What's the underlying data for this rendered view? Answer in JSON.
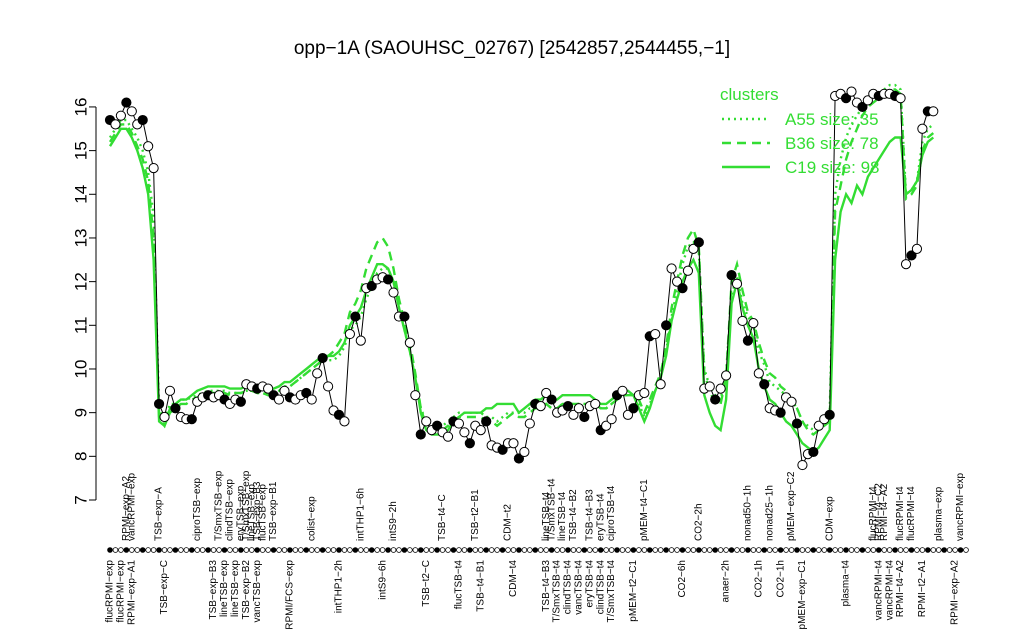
{
  "chart_data": {
    "type": "line",
    "title": "opp−1A (SAOUHSC_02767) [2542857,2544455,−1]",
    "ylim": [
      7,
      16.8
    ],
    "yticks": [
      7,
      8,
      9,
      10,
      11,
      12,
      13,
      14,
      15,
      16
    ],
    "n_samples": 158,
    "top_labels": [
      {
        "i": 3,
        "label": "RPMI−exp−A2"
      },
      {
        "i": 4,
        "label": "vancRPMI−exp"
      },
      {
        "i": 9,
        "label": "TSB−exp−A"
      },
      {
        "i": 16,
        "label": "ciproTSB−exp"
      },
      {
        "i": 20,
        "label": "T/SmxTSB−exp"
      },
      {
        "i": 22,
        "label": "clindTSB−exp"
      },
      {
        "i": 24,
        "label": "eryTSB−exp"
      },
      {
        "i": 25,
        "label": "T/SmxTSB−exp"
      },
      {
        "i": 26,
        "label": "lineTSB−exp"
      },
      {
        "i": 27,
        "label": "TSB−exp−B3"
      },
      {
        "i": 28,
        "label": "flucTSB−exp"
      },
      {
        "i": 30,
        "label": "TSB−exp−B1"
      },
      {
        "i": 37,
        "label": "colist−exp"
      },
      {
        "i": 46,
        "label": "intTHP1−6h"
      },
      {
        "i": 52,
        "label": "intS9−2h"
      },
      {
        "i": 61,
        "label": "TSB−t4−C"
      },
      {
        "i": 67,
        "label": "TSB−t2−B1"
      },
      {
        "i": 73,
        "label": "CDM−t2"
      },
      {
        "i": 80,
        "label": "lineTSB−t4"
      },
      {
        "i": 81,
        "label": "T/SmxTSB−t4"
      },
      {
        "i": 83,
        "label": "lineTSB−t4"
      },
      {
        "i": 85,
        "label": "TSB−t4−B2"
      },
      {
        "i": 88,
        "label": "TSB−t4−B3"
      },
      {
        "i": 90,
        "label": "eryTSB−t4"
      },
      {
        "i": 92,
        "label": "ciproTSB−t4"
      },
      {
        "i": 98,
        "label": "pMEM−t4−C1"
      },
      {
        "i": 108,
        "label": "CO2−2h"
      },
      {
        "i": 117,
        "label": "nonad50−1h"
      },
      {
        "i": 121,
        "label": "nonad25−1h"
      },
      {
        "i": 125,
        "label": "pMEM−exp−C2"
      },
      {
        "i": 132,
        "label": "CDM−exp"
      },
      {
        "i": 140,
        "label": "flucRPMI−t4"
      },
      {
        "i": 141,
        "label": "RPMI−t4−C2"
      },
      {
        "i": 142,
        "label": "RPMI−t4−A2"
      },
      {
        "i": 145,
        "label": "flucRPMI−t4"
      },
      {
        "i": 147,
        "label": "flucRPMI−t4"
      },
      {
        "i": 152,
        "label": "plasma−exp"
      },
      {
        "i": 156,
        "label": "vancRPMI−exp"
      }
    ],
    "bottom_labels": [
      {
        "i": 0,
        "label": "flucRPMI−exp"
      },
      {
        "i": 2,
        "label": "flucRPMI−exp"
      },
      {
        "i": 4,
        "label": "RPMI−exp−A1"
      },
      {
        "i": 10,
        "label": "TSB−exp−C"
      },
      {
        "i": 19,
        "label": "TSB−exp−B3"
      },
      {
        "i": 21,
        "label": "lineTSB−exp"
      },
      {
        "i": 23,
        "label": "lineTSB−exp"
      },
      {
        "i": 25,
        "label": "TSB−exp−B2"
      },
      {
        "i": 27,
        "label": "vancTSB−exp"
      },
      {
        "i": 33,
        "label": "RPMI/FCS−exp"
      },
      {
        "i": 42,
        "label": "intTHP1−2h"
      },
      {
        "i": 50,
        "label": "intS9−6h"
      },
      {
        "i": 58,
        "label": "TSB−t2−C"
      },
      {
        "i": 64,
        "label": "flucTSB−t4"
      },
      {
        "i": 68,
        "label": "TSB−t4−B1"
      },
      {
        "i": 74,
        "label": "CDM−t4"
      },
      {
        "i": 80,
        "label": "TSB−t4−B3"
      },
      {
        "i": 82,
        "label": "T/SmxTSB−t4"
      },
      {
        "i": 84,
        "label": "clindTSB−t4"
      },
      {
        "i": 86,
        "label": "vancTSB−t4"
      },
      {
        "i": 88,
        "label": "eryTSB−t4"
      },
      {
        "i": 90,
        "label": "clindTSB−t4"
      },
      {
        "i": 92,
        "label": "T/SmxTSB−t4"
      },
      {
        "i": 96,
        "label": "pMEM−t2−C1"
      },
      {
        "i": 105,
        "label": "CO2−6h"
      },
      {
        "i": 113,
        "label": "anaer−2h"
      },
      {
        "i": 119,
        "label": "CO2−1h"
      },
      {
        "i": 123,
        "label": "CO2−1h"
      },
      {
        "i": 127,
        "label": "pMEM−exp−C1"
      },
      {
        "i": 135,
        "label": "plasma−t4"
      },
      {
        "i": 141,
        "label": "vancRPMI−t4"
      },
      {
        "i": 143,
        "label": "vancRPMI−t4"
      },
      {
        "i": 145,
        "label": "RPMI−t4−A2"
      },
      {
        "i": 149,
        "label": "RPMI−t2−A1"
      },
      {
        "i": 155,
        "label": "RPMI−exp−A2"
      }
    ],
    "series": [
      {
        "name": "opp−1A",
        "style": "black line with points",
        "values": [
          15.7,
          15.6,
          15.8,
          16.1,
          15.9,
          15.6,
          15.7,
          15.1,
          14.6,
          9.2,
          8.9,
          9.5,
          9.1,
          8.9,
          8.85,
          8.85,
          9.25,
          9.35,
          9.4,
          9.35,
          9.4,
          9.3,
          9.2,
          9.3,
          9.25,
          9.65,
          9.6,
          9.55,
          9.6,
          9.55,
          9.4,
          9.3,
          9.5,
          9.35,
          9.3,
          9.4,
          9.45,
          9.3,
          9.9,
          10.25,
          9.6,
          9.05,
          8.95,
          8.8,
          10.8,
          11.2,
          10.65,
          11.85,
          11.9,
          12.05,
          12.1,
          12.05,
          11.75,
          11.2,
          11.2,
          10.6,
          9.4,
          8.5,
          8.8,
          8.6,
          8.7,
          8.55,
          8.45,
          8.8,
          8.75,
          8.55,
          8.3,
          8.7,
          8.6,
          8.8,
          8.25,
          8.2,
          8.15,
          8.3,
          8.3,
          7.95,
          8.1,
          8.75,
          9.2,
          9.15,
          9.45,
          9.3,
          9.0,
          9.05,
          9.15,
          8.95,
          9.1,
          8.9,
          9.15,
          9.2,
          8.6,
          8.7,
          8.85,
          9.4,
          9.5,
          8.95,
          9.1,
          9.4,
          9.45,
          10.75,
          10.8,
          9.65,
          11.0,
          12.3,
          12.0,
          11.85,
          12.25,
          12.75,
          12.9,
          9.55,
          9.6,
          9.3,
          9.55,
          9.85,
          12.15,
          11.95,
          11.1,
          10.65,
          11.05,
          9.9,
          9.65,
          9.1,
          9.05,
          9.0,
          9.35,
          9.25,
          8.75,
          7.8,
          8.05,
          8.1,
          8.7,
          8.85,
          8.95,
          16.25,
          16.3,
          16.2,
          16.35,
          16.1,
          16.0,
          16.15,
          16.3,
          16.25,
          16.3,
          16.3,
          16.25,
          16.2,
          12.4,
          12.6,
          12.75,
          15.5,
          15.9,
          15.9
        ]
      },
      {
        "name": "A55 size: 35",
        "style": "dotted",
        "values": [
          15.3,
          15.5,
          15.7,
          15.7,
          15.5,
          15.3,
          15.0,
          14.5,
          13.5,
          9.1,
          8.8,
          9.2,
          9.2,
          9.3,
          9.3,
          9.35,
          9.4,
          9.45,
          9.5,
          9.5,
          9.5,
          9.5,
          9.45,
          9.45,
          9.45,
          9.5,
          9.5,
          9.45,
          9.45,
          9.4,
          9.45,
          9.5,
          9.6,
          9.6,
          9.7,
          9.8,
          9.9,
          10.0,
          10.1,
          10.2,
          10.2,
          10.2,
          10.3,
          10.5,
          10.9,
          11.0,
          11.2,
          11.6,
          11.9,
          12.2,
          12.3,
          12.3,
          12.0,
          11.4,
          10.9,
          10.4,
          9.8,
          9.1,
          8.8,
          8.7,
          8.7,
          8.7,
          8.8,
          8.9,
          9.0,
          9.0,
          9.0,
          9.0,
          9.0,
          8.9,
          8.9,
          8.8,
          8.9,
          9.0,
          9.0,
          9.0,
          9.0,
          9.1,
          9.1,
          9.1,
          9.2,
          9.1,
          9.1,
          9.2,
          9.2,
          9.2,
          9.2,
          9.2,
          9.2,
          9.2,
          9.1,
          9.1,
          9.2,
          9.3,
          9.4,
          9.4,
          9.4,
          9.2,
          8.9,
          9.2,
          9.5,
          9.8,
          10.4,
          11.2,
          11.8,
          12.4,
          12.8,
          12.9,
          12.7,
          10.0,
          9.6,
          9.4,
          9.3,
          9.9,
          11.7,
          12.1,
          11.5,
          11.2,
          11.0,
          10.4,
          10.1,
          9.7,
          9.6,
          9.5,
          9.4,
          9.3,
          9.1,
          8.8,
          8.7,
          8.6,
          8.7,
          8.8,
          9.0,
          14.0,
          14.8,
          15.3,
          15.6,
          15.8,
          16.0,
          16.1,
          16.2,
          16.3,
          16.4,
          16.5,
          16.5,
          16.4,
          14.0,
          14.1,
          14.3,
          15.2,
          15.5,
          15.6
        ]
      },
      {
        "name": "B36 size: 78",
        "style": "dashed",
        "values": [
          15.2,
          15.4,
          15.6,
          15.6,
          15.4,
          15.1,
          14.8,
          14.3,
          13.0,
          8.9,
          8.7,
          9.0,
          9.1,
          9.2,
          9.2,
          9.3,
          9.35,
          9.4,
          9.45,
          9.45,
          9.45,
          9.45,
          9.4,
          9.45,
          9.45,
          9.5,
          9.5,
          9.45,
          9.45,
          9.4,
          9.45,
          9.5,
          9.6,
          9.6,
          9.7,
          9.8,
          9.9,
          10.0,
          10.1,
          10.2,
          10.3,
          10.4,
          10.6,
          10.8,
          11.3,
          11.5,
          11.8,
          12.3,
          12.6,
          12.9,
          13.0,
          12.8,
          12.3,
          11.6,
          11.1,
          10.6,
          9.9,
          9.1,
          8.7,
          8.6,
          8.6,
          8.6,
          8.7,
          8.8,
          8.9,
          8.9,
          8.9,
          8.9,
          8.9,
          8.8,
          8.8,
          8.7,
          8.8,
          8.9,
          9.0,
          8.9,
          8.9,
          9.0,
          9.1,
          9.1,
          9.2,
          9.1,
          9.1,
          9.2,
          9.2,
          9.2,
          9.2,
          9.2,
          9.2,
          9.2,
          9.1,
          9.1,
          9.2,
          9.3,
          9.4,
          9.4,
          9.4,
          9.3,
          9.0,
          9.3,
          9.6,
          9.9,
          10.5,
          11.4,
          12.0,
          12.6,
          13.0,
          13.2,
          12.8,
          9.9,
          9.5,
          9.2,
          9.2,
          9.8,
          12.0,
          12.4,
          11.8,
          11.3,
          11.1,
          10.6,
          10.2,
          9.9,
          9.8,
          9.6,
          9.5,
          9.3,
          9.1,
          8.8,
          8.6,
          8.5,
          8.6,
          8.7,
          8.8,
          13.6,
          14.2,
          14.8,
          15.2,
          15.5,
          15.8,
          16.0,
          16.1,
          16.2,
          16.3,
          16.4,
          16.4,
          16.3,
          13.9,
          14.0,
          14.2,
          15.0,
          15.3,
          15.4
        ]
      },
      {
        "name": "C19 size: 98",
        "style": "solid",
        "values": [
          15.1,
          15.3,
          15.5,
          15.5,
          15.3,
          15.0,
          14.6,
          14.0,
          12.5,
          8.8,
          8.7,
          9.1,
          9.2,
          9.3,
          9.3,
          9.4,
          9.5,
          9.55,
          9.6,
          9.6,
          9.6,
          9.6,
          9.55,
          9.55,
          9.55,
          9.6,
          9.6,
          9.55,
          9.55,
          9.5,
          9.55,
          9.6,
          9.7,
          9.7,
          9.8,
          9.9,
          10.0,
          10.1,
          10.2,
          10.3,
          10.3,
          10.3,
          10.4,
          10.6,
          11.0,
          11.2,
          11.4,
          11.8,
          12.1,
          12.4,
          12.4,
          12.3,
          12.0,
          11.4,
          10.9,
          10.4,
          9.8,
          9.0,
          8.6,
          8.5,
          8.5,
          8.5,
          8.6,
          8.8,
          8.9,
          9.0,
          9.0,
          9.0,
          9.0,
          9.1,
          9.1,
          9.2,
          9.2,
          9.2,
          9.2,
          9.0,
          9.1,
          9.2,
          9.3,
          9.3,
          9.4,
          9.3,
          9.3,
          9.4,
          9.4,
          9.4,
          9.4,
          9.4,
          9.4,
          9.3,
          9.2,
          9.2,
          9.3,
          9.4,
          9.5,
          9.5,
          9.4,
          9.1,
          8.8,
          9.1,
          9.5,
          9.8,
          10.3,
          11.1,
          11.6,
          12.0,
          12.3,
          12.5,
          12.2,
          9.4,
          9.0,
          8.7,
          8.6,
          9.3,
          11.5,
          12.0,
          11.4,
          11.0,
          10.7,
          10.0,
          9.6,
          9.3,
          9.2,
          9.0,
          8.8,
          8.7,
          8.5,
          8.3,
          8.2,
          8.1,
          8.2,
          8.4,
          8.6,
          12.5,
          13.6,
          14.0,
          13.8,
          14.2,
          14.0,
          14.4,
          14.6,
          14.8,
          15.0,
          15.2,
          15.3,
          15.3,
          14.0,
          14.1,
          14.3,
          14.9,
          15.2,
          15.3
        ]
      }
    ],
    "legend": {
      "title": "clusters",
      "position": "top-right",
      "entries": [
        {
          "label": "A55 size: 35",
          "style": "dotted"
        },
        {
          "label": "B36 size: 78",
          "style": "dashed"
        },
        {
          "label": "C19 size: 98",
          "style": "solid"
        }
      ],
      "color": "#33dd33"
    },
    "colors": {
      "main": "#000000",
      "clusters": "#33dd33",
      "open_point": "#ffffff"
    }
  }
}
